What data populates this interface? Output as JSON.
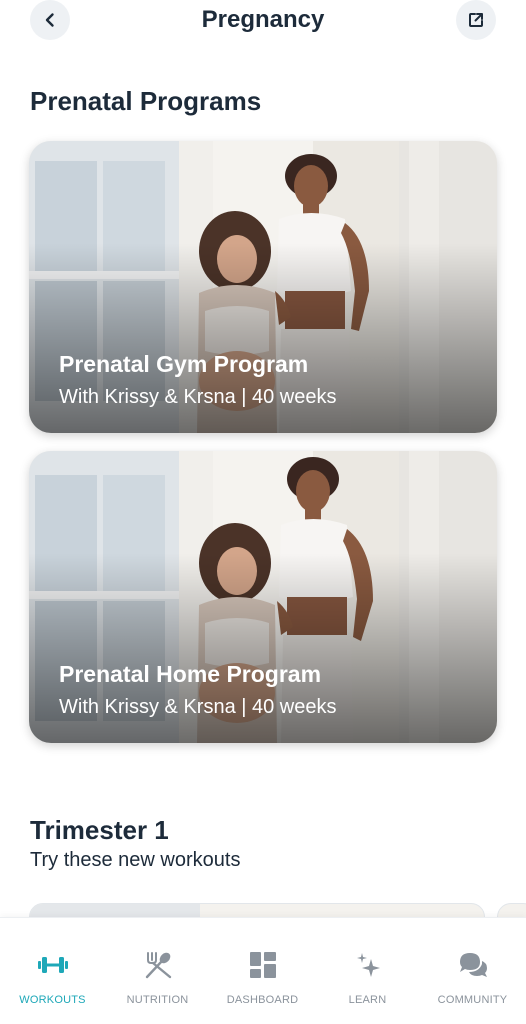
{
  "header": {
    "title": "Pregnancy",
    "back_icon": "chevron-left-icon",
    "share_icon": "external-link-icon"
  },
  "sections": {
    "prenatal": {
      "title": "Prenatal Programs",
      "cards": [
        {
          "title": "Prenatal Gym Program",
          "subtitle": "With Krissy & Krsna | 40 weeks"
        },
        {
          "title": "Prenatal Home Program",
          "subtitle": "With Krissy & Krsna | 40 weeks"
        }
      ]
    },
    "trimester": {
      "title": "Trimester 1",
      "subtitle": "Try these new workouts"
    }
  },
  "tabbar": {
    "active_color": "#1ea8b8",
    "inactive_color": "#8b939c",
    "items": [
      {
        "label": "WORKOUTS",
        "icon": "dumbbell-icon"
      },
      {
        "label": "NUTRITION",
        "icon": "fork-spoon-icon"
      },
      {
        "label": "DASHBOARD",
        "icon": "dashboard-icon"
      },
      {
        "label": "LEARN",
        "icon": "sparkle-icon"
      },
      {
        "label": "COMMUNITY",
        "icon": "chat-bubbles-icon"
      }
    ]
  }
}
